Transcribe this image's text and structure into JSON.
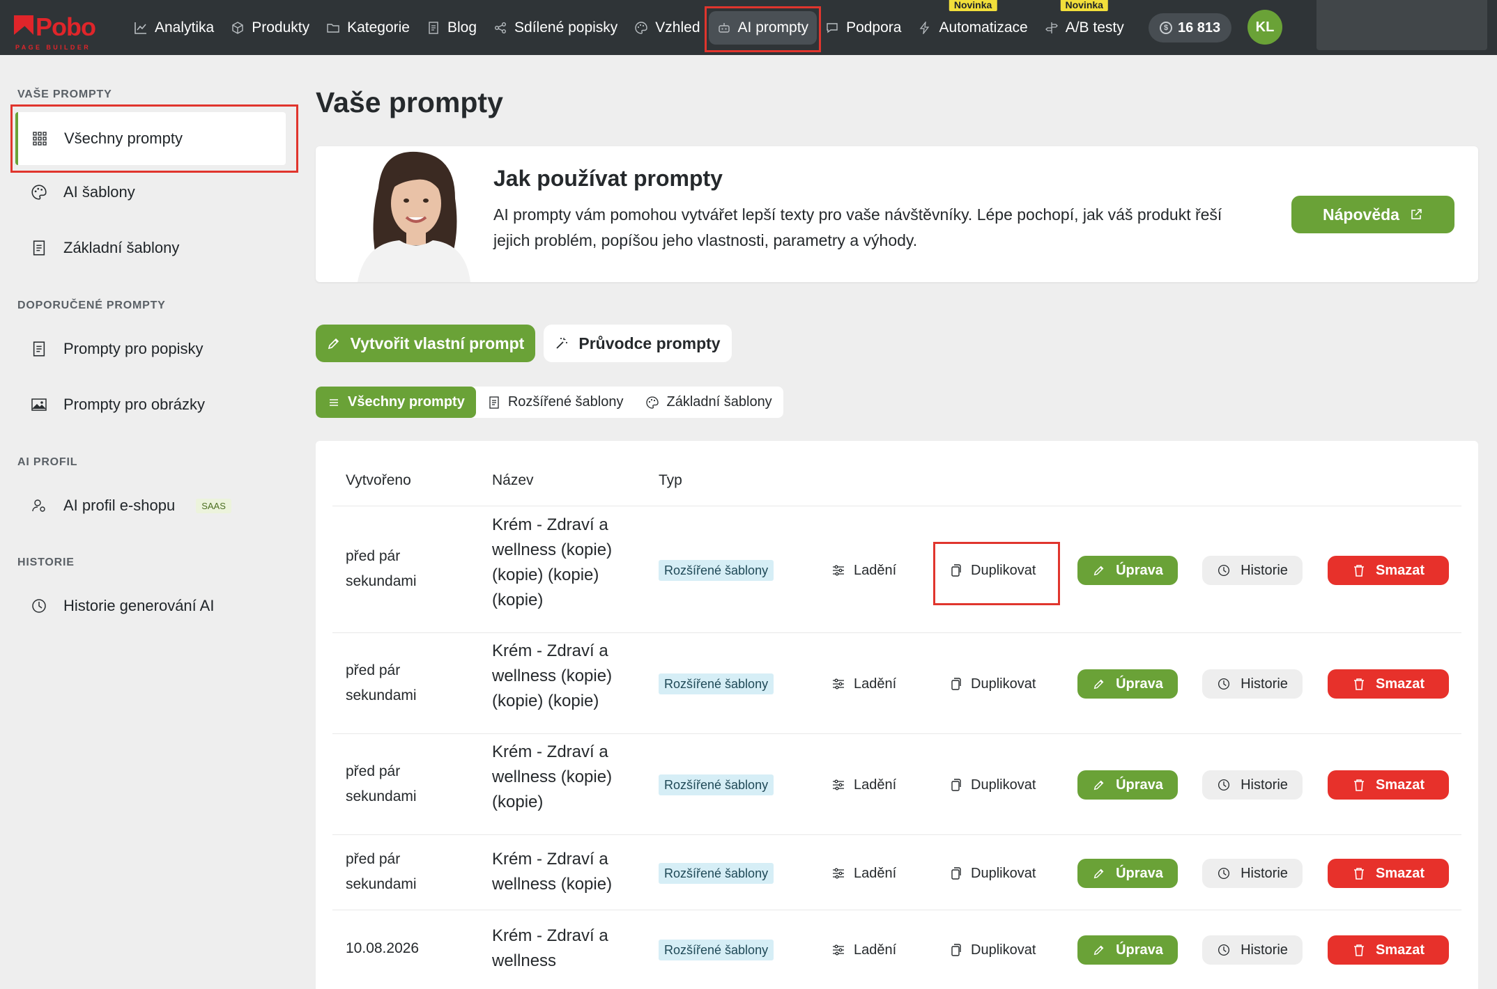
{
  "brand": {
    "name": "Pobo",
    "tagline": "PAGE BUILDER",
    "accent": "#6aa237",
    "danger": "#e7312b",
    "logo_color": "#e0252a"
  },
  "nav": {
    "items": [
      {
        "label": "Analytika",
        "icon": "chart-line-icon"
      },
      {
        "label": "Produkty",
        "icon": "cube-icon"
      },
      {
        "label": "Kategorie",
        "icon": "folder-icon"
      },
      {
        "label": "Blog",
        "icon": "document-icon"
      },
      {
        "label": "Sdílené popisky",
        "icon": "share-icon"
      },
      {
        "label": "Vzhled",
        "icon": "palette-icon"
      },
      {
        "label": "AI prompty",
        "icon": "robot-icon",
        "active": true
      },
      {
        "label": "Podpora",
        "icon": "chat-bubble-icon"
      },
      {
        "label": "Automatizace",
        "icon": "bolt-icon",
        "badge": "Novinka"
      },
      {
        "label": "A/B testy",
        "icon": "signpost-icon",
        "badge": "Novinka"
      }
    ],
    "credits": "16 813",
    "avatar_initials": "KL"
  },
  "sidebar": {
    "sections": [
      {
        "title": "VAŠE PROMPTY"
      },
      {
        "title": "DOPORUČENÉ PROMPTY"
      },
      {
        "title": "AI PROFIL"
      },
      {
        "title": "HISTORIE"
      }
    ],
    "items": [
      {
        "label": "Všechny prompty",
        "icon": "grid-icon",
        "active": true
      },
      {
        "label": "AI šablony",
        "icon": "palette-icon"
      },
      {
        "label": "Základní šablony",
        "icon": "document-icon"
      },
      {
        "label": "Prompty pro popisky",
        "icon": "document-icon"
      },
      {
        "label": "Prompty pro obrázky",
        "icon": "image-icon"
      },
      {
        "label": "AI profil e-shopu",
        "icon": "user-gear-icon",
        "badge": "SAAS"
      },
      {
        "label": "Historie generování AI",
        "icon": "clock-icon"
      }
    ]
  },
  "page": {
    "title": "Vaše prompty"
  },
  "info": {
    "title": "Jak používat prompty",
    "text": "AI prompty vám pomohou vytvářet lepší texty pro vaše návštěvníky. Lépe pochopí, jak váš produkt řeší jejich problém, popíšou jeho vlastnosti, parametry a výhody.",
    "help_label": "Nápověda"
  },
  "actions": {
    "create_label": "Vytvořit vlastní prompt",
    "guide_label": "Průvodce prompty"
  },
  "tabs": [
    {
      "label": "Všechny prompty",
      "icon": "list-icon",
      "active": true
    },
    {
      "label": "Rozšířené šablony",
      "icon": "document-icon"
    },
    {
      "label": "Základní šablony",
      "icon": "palette-icon"
    }
  ],
  "table": {
    "headers": {
      "created": "Vytvořeno",
      "name": "Název",
      "type": "Typ"
    },
    "action_labels": {
      "tune": "Ladění",
      "duplicate": "Duplikovat",
      "edit": "Úprava",
      "history": "Historie",
      "delete": "Smazat"
    },
    "rows": [
      {
        "created": "před pár sekundami",
        "name": "Krém - Zdraví a wellness (kopie) (kopie) (kopie) (kopie)",
        "type": "Rozšířené šablony"
      },
      {
        "created": "před pár sekundami",
        "name": "Krém - Zdraví a wellness (kopie) (kopie) (kopie)",
        "type": "Rozšířené šablony"
      },
      {
        "created": "před pár sekundami",
        "name": "Krém - Zdraví a wellness (kopie) (kopie)",
        "type": "Rozšířené šablony"
      },
      {
        "created": "před pár sekundami",
        "name": "Krém - Zdraví a wellness (kopie)",
        "type": "Rozšířené šablony"
      },
      {
        "created": "10.08.2026",
        "name": "Krém - Zdraví a wellness",
        "type": "Rozšířené šablony"
      }
    ]
  }
}
